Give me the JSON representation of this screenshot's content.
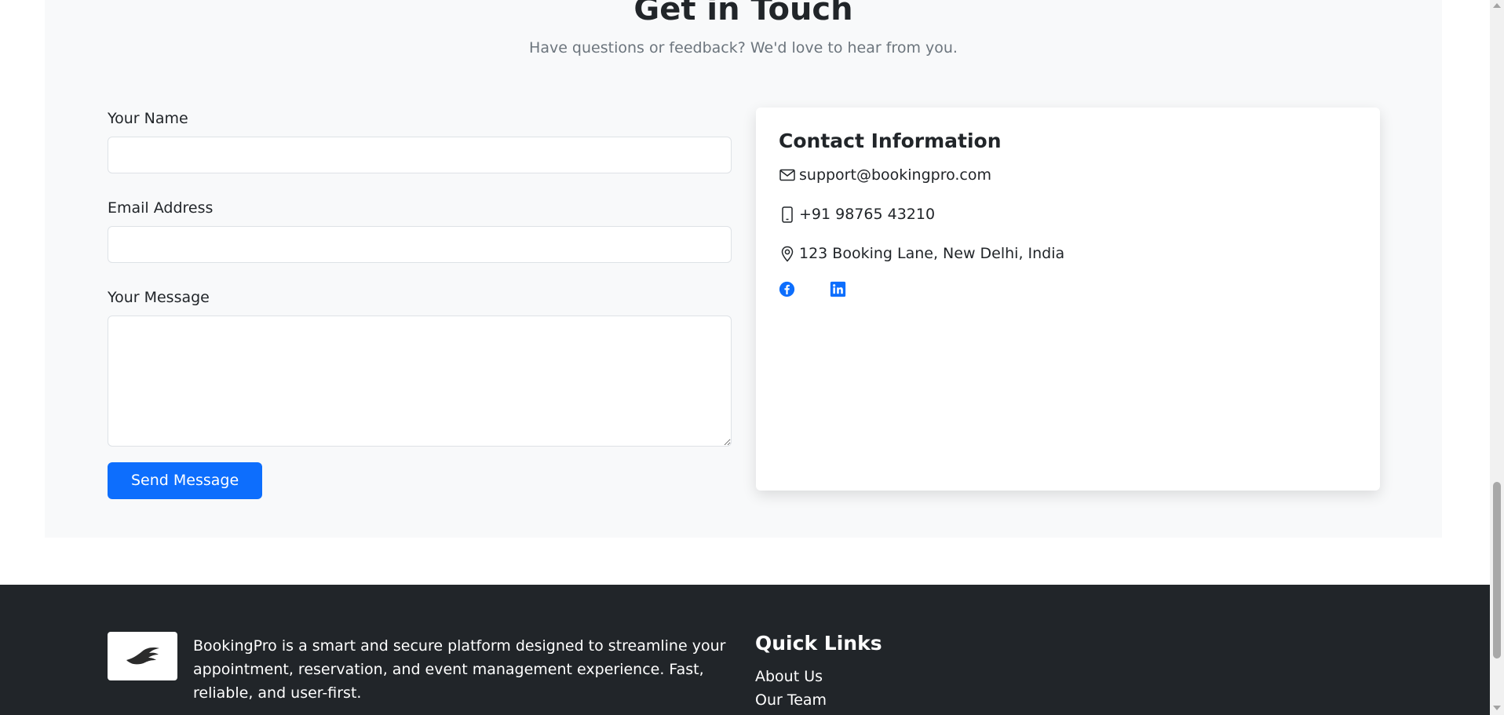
{
  "contact": {
    "title": "Get in Touch",
    "subtitle": "Have questions or feedback? We'd love to hear from you."
  },
  "form": {
    "name_label": "Your Name",
    "name_value": "",
    "email_label": "Email Address",
    "email_value": "",
    "message_label": "Your Message",
    "message_value": "",
    "submit_label": "Send Message"
  },
  "info": {
    "title": "Contact Information",
    "email": "support@bookingpro.com",
    "phone": "+91 98765 43210",
    "address": "123 Booking Lane, New Delhi, India",
    "socials": [
      {
        "icon": "facebook-icon",
        "color": "#0d6efd"
      },
      {
        "icon": "linkedin-icon",
        "color": "#0d6efd"
      }
    ]
  },
  "footer": {
    "about": "BookingPro is a smart and secure platform designed to streamline your appointment, reservation, and event management experience. Fast, reliable, and user-first.",
    "quick_links_title": "Quick Links",
    "quick_links": [
      "About Us",
      "Our Team"
    ]
  },
  "colors": {
    "primary": "#0d6efd",
    "section_bg": "#f8f9fa",
    "footer_bg": "#212529"
  }
}
